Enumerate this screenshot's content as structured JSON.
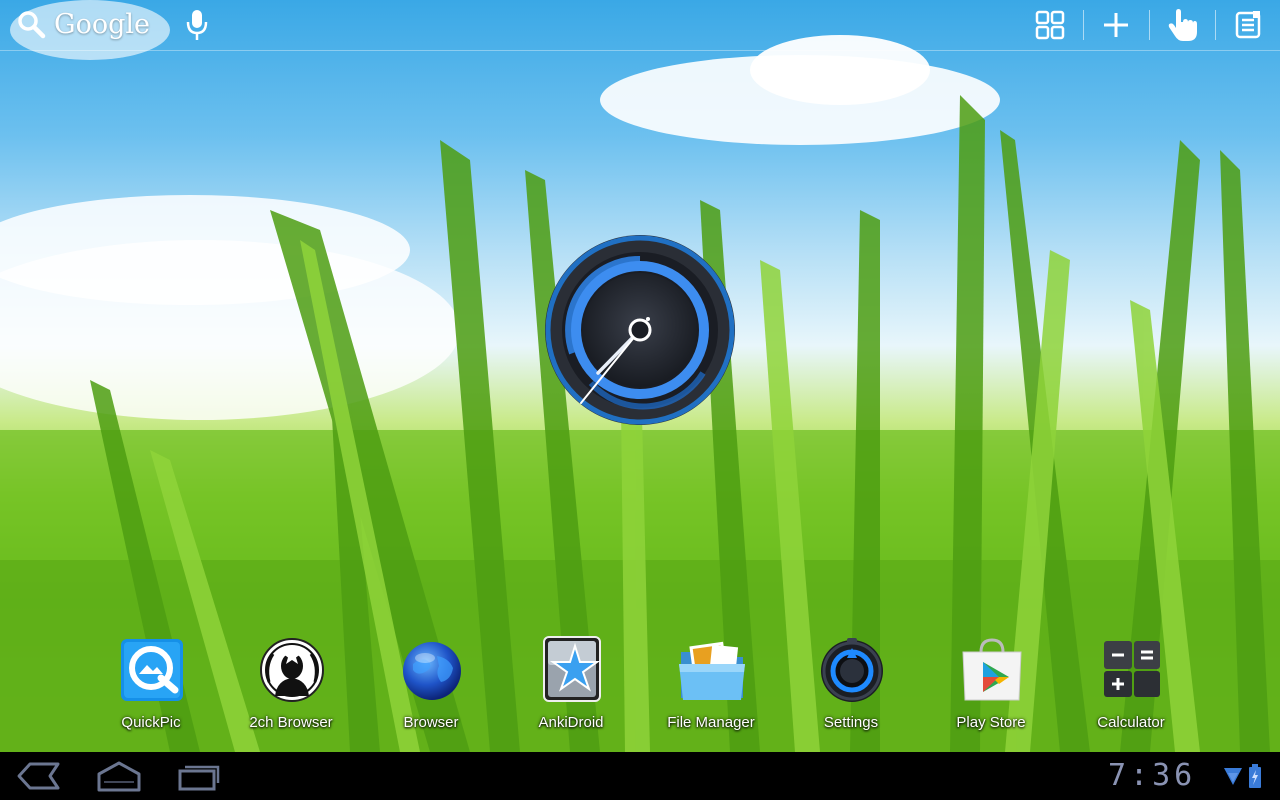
{
  "search": {
    "brand": "Google"
  },
  "top_actions": [
    {
      "id": "apps",
      "icon": "apps-grid-icon"
    },
    {
      "id": "add",
      "icon": "plus-icon"
    },
    {
      "id": "touch",
      "icon": "hand-pointer-icon"
    },
    {
      "id": "menu",
      "icon": "notes-menu-icon"
    }
  ],
  "apps": [
    {
      "label": "QuickPic",
      "icon": "quickpic-icon"
    },
    {
      "label": "2ch Browser",
      "icon": "2ch-browser-icon"
    },
    {
      "label": "Browser",
      "icon": "globe-icon"
    },
    {
      "label": "AnkiDroid",
      "icon": "ankidroid-star-icon"
    },
    {
      "label": "File Manager",
      "icon": "folder-icon"
    },
    {
      "label": "Settings",
      "icon": "settings-icon"
    },
    {
      "label": "Play Store",
      "icon": "play-store-icon"
    },
    {
      "label": "Calculator",
      "icon": "calculator-icon"
    }
  ],
  "system_bar": {
    "time": "7:36",
    "nav": [
      "back-icon",
      "home-icon",
      "recent-apps-icon"
    ]
  },
  "colors": {
    "accent_blue": "#1e7bdc",
    "clock_text": "#8a93b3",
    "system_bar": "#000000"
  }
}
